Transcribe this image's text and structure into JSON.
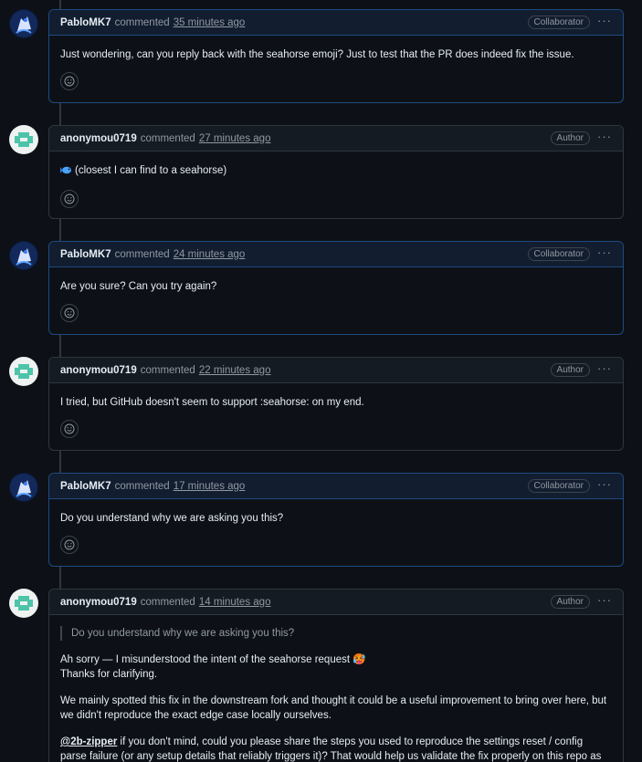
{
  "comments": [
    {
      "author": "PabloMK7",
      "verb": "commented",
      "time": "35 minutes ago",
      "role": "Collaborator",
      "body": "Just wondering, can you reply back with the seahorse emoji? Just to test that the PR does indeed fix the issue."
    },
    {
      "author": "anonymou0719",
      "verb": "commented",
      "time": "27 minutes ago",
      "role": "Author",
      "body": "(closest I can find to a seahorse)"
    },
    {
      "author": "PabloMK7",
      "verb": "commented",
      "time": "24 minutes ago",
      "role": "Collaborator",
      "body": "Are you sure? Can you try again?"
    },
    {
      "author": "anonymou0719",
      "verb": "commented",
      "time": "22 minutes ago",
      "role": "Author",
      "body": "I tried, but GitHub doesn't seem to support :seahorse: on my end."
    },
    {
      "author": "PabloMK7",
      "verb": "commented",
      "time": "17 minutes ago",
      "role": "Collaborator",
      "body": "Do you understand why we are asking you this?"
    },
    {
      "author": "anonymou0719",
      "verb": "commented",
      "time": "14 minutes ago",
      "role": "Author",
      "quote": "Do you understand why we are asking you this?",
      "p1_line1": "Ah sorry — I misunderstood the intent of the seahorse request 🥵",
      "p1_line2": "Thanks for clarifying.",
      "p2": "We mainly spotted this fix in the downstream fork and thought it could be a useful improvement to bring over here, but we didn't reproduce the exact edge case locally ourselves.",
      "mention": "@2b-zipper",
      "p3": " if you don't mind, could you please share the steps you used to reproduce the settings reset / config parse failure (or any setup details that reliably triggers it)? That would help us validate the fix properly on this repo as well."
    }
  ],
  "icons": {
    "kebab": "kebab-horizontal-icon",
    "reaction": "smiley-icon",
    "fish": "fish-emoji-icon"
  },
  "colors": {
    "background": "#0d1117",
    "border": "#30363d",
    "collaborator_border": "#1f4a80",
    "muted": "#9198a1"
  }
}
